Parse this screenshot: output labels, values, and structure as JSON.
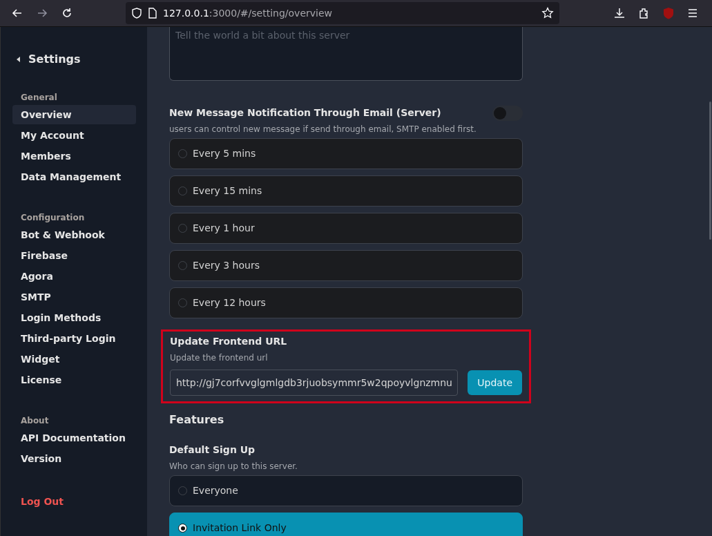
{
  "browser": {
    "url_host": "127.0.0.1",
    "url_rest": ":3000/#/setting/overview",
    "forward_disabled": true
  },
  "sidebar": {
    "title": "Settings",
    "groups": [
      {
        "heading": "General",
        "items": [
          {
            "label": "Overview",
            "selected": true
          },
          {
            "label": "My Account",
            "selected": false
          },
          {
            "label": "Members",
            "selected": false
          },
          {
            "label": "Data Management",
            "selected": false
          }
        ]
      },
      {
        "heading": "Configuration",
        "items": [
          {
            "label": "Bot & Webhook",
            "selected": false
          },
          {
            "label": "Firebase",
            "selected": false
          },
          {
            "label": "Agora",
            "selected": false
          },
          {
            "label": "SMTP",
            "selected": false
          },
          {
            "label": "Login Methods",
            "selected": false
          },
          {
            "label": "Third-party Login",
            "selected": false
          },
          {
            "label": "Widget",
            "selected": false
          },
          {
            "label": "License",
            "selected": false
          }
        ]
      },
      {
        "heading": "About",
        "items": [
          {
            "label": "API Documentation",
            "selected": false
          },
          {
            "label": "Version",
            "selected": false
          }
        ]
      }
    ],
    "logout": "Log Out"
  },
  "description_field": {
    "placeholder": "Tell the world a bit about this server"
  },
  "email_notification": {
    "title": "New Message Notification Through Email (Server)",
    "description": "users can control new message if send through email, SMTP enabled first.",
    "on": false,
    "options": [
      {
        "label": "Every 5 mins",
        "selected": false
      },
      {
        "label": "Every 15 mins",
        "selected": false
      },
      {
        "label": "Every 1 hour",
        "selected": false
      },
      {
        "label": "Every 3 hours",
        "selected": false
      },
      {
        "label": "Every 12 hours",
        "selected": false
      }
    ]
  },
  "frontend_url": {
    "title": "Update Frontend URL",
    "description": "Update the frontend url",
    "value": "http://gj7corfvvglgmlgdb3rjuobsymmr5w2qpoyvlgnzmnu",
    "button": "Update",
    "highlighted": true
  },
  "features": {
    "heading": "Features"
  },
  "default_sign_up": {
    "title": "Default Sign Up",
    "description": "Who can sign up to this server.",
    "options": [
      {
        "label": "Everyone",
        "selected": false
      },
      {
        "label": "Invitation Link Only",
        "selected": true
      }
    ]
  }
}
